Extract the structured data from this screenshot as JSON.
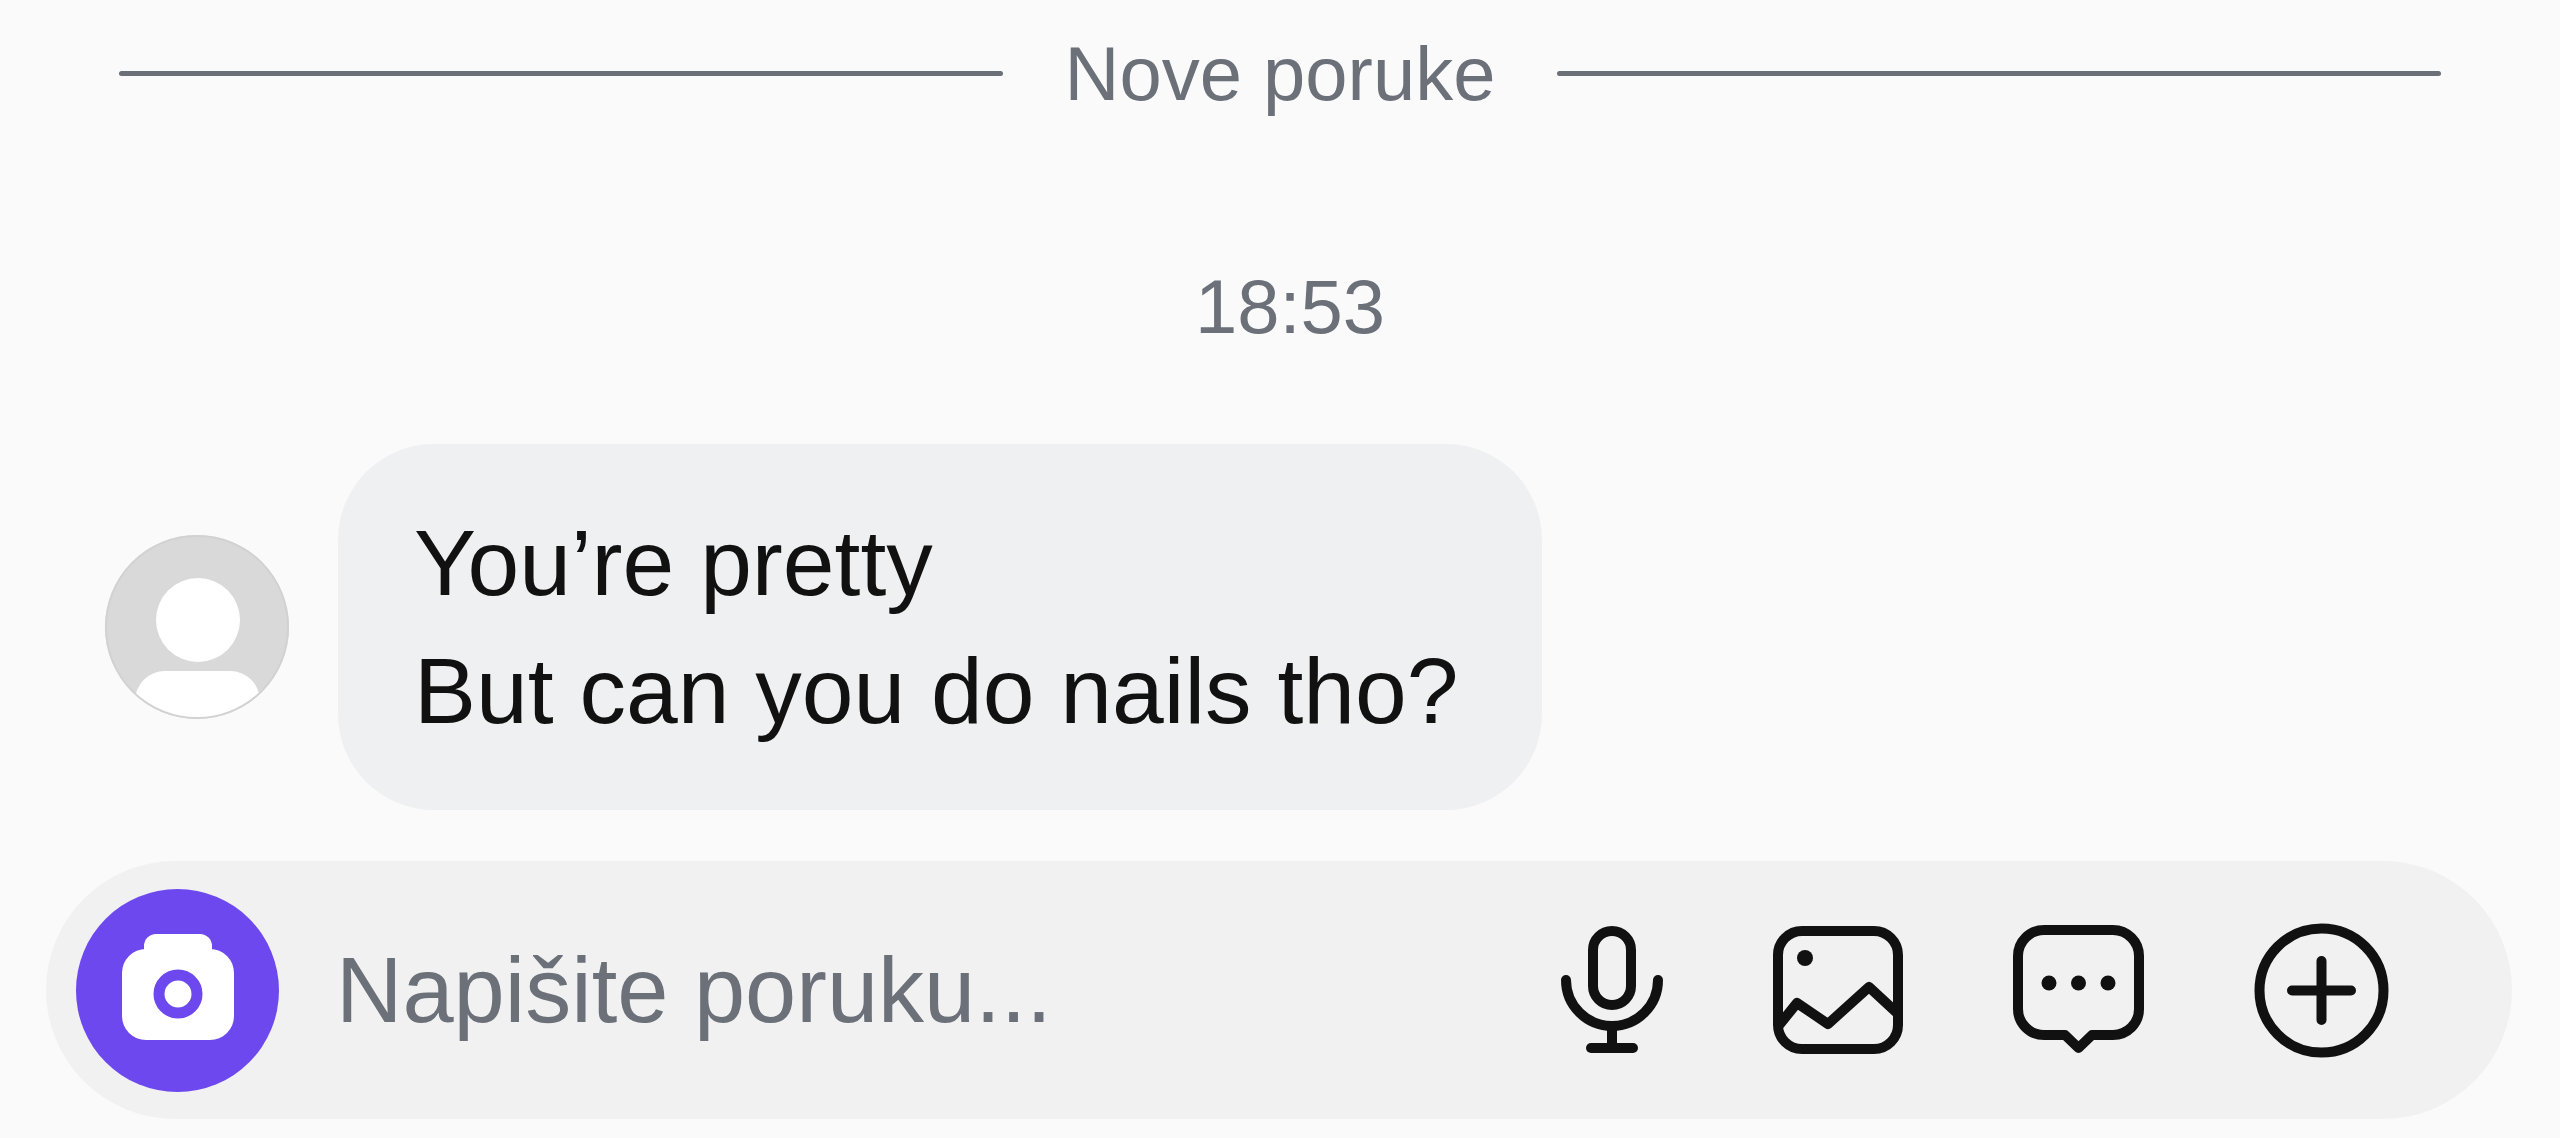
{
  "divider": {
    "label": "Nove poruke"
  },
  "timestamp": "18:53",
  "message": {
    "lines": [
      "You’re pretty",
      "But can you do nails tho?"
    ]
  },
  "composer": {
    "placeholder": "Napišite poruku..."
  }
}
